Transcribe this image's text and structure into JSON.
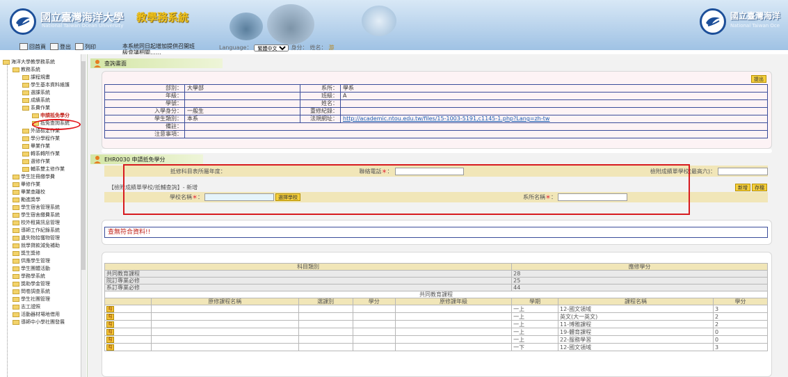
{
  "banner": {
    "school_name": "國立臺灣海洋大學",
    "school_name_en": "National Taiwan Ocean University",
    "system_name": "教學務系統",
    "school_name_right": "國立臺灣海洋",
    "school_name_en_right": "National Taiwan Oce"
  },
  "toolbar": {
    "home": "回首頁",
    "logout": "登出",
    "print": "列印",
    "notice": "本系統同日起增加提供召開班",
    "notice2": "級會議相關……",
    "language_label": "Language：",
    "language_value": "繁體中文",
    "user_label": "身分：",
    "name_label": "姓名：",
    "name_value": "游"
  },
  "sidebar": {
    "root": "海洋大學教學務系統",
    "items": [
      "教務系統",
      "課程規畫",
      "學生基本資料維護",
      "選課系統",
      "成績系統",
      "系費作業",
      "申請抵免學分",
      "抵免查詢系統",
      "外語檢定作業",
      "學分學程作業",
      "畢業作業",
      "轉系轉所作業",
      "選修作業",
      "輔系雙主修作業",
      "學生註冊繳學費",
      "畢修作業",
      "畢業查離校",
      "勵進獎學",
      "學生宿舍管理系統",
      "學生宿舍繳費系統",
      "校外租賃訊息管理",
      "導師工作紀錄系統",
      "遺失物拾獲物管理",
      "就學貸款減免補助",
      "獎生獎修",
      "供應學生管理",
      "學生團體活動",
      "學務學系統",
      "獎助學金管理",
      "問卷調查系統",
      "學生社團管理",
      "志工證照",
      "活動器材場地借用",
      "導師中小學社團發展"
    ]
  },
  "query": {
    "title": "查詢畫面",
    "button": "提出",
    "rows": [
      {
        "l1": "部別：",
        "v1": "大學部",
        "l2": "系所：",
        "v2": "學系"
      },
      {
        "l1": "年級：",
        "v1": "",
        "l2": "班級：",
        "v2": "A"
      },
      {
        "l1": "學號：",
        "v1": "",
        "l2": "姓名：",
        "v2": ""
      },
      {
        "l1": "入學身分：",
        "v1": "一般生",
        "l2": "重修紀錄：",
        "v2": ""
      },
      {
        "l1": "學生類別：",
        "v1": "本系",
        "l2": "法規網址：",
        "v2": "http://academic.ntou.edu.tw/files/15-1003-5191,c1145-1.php?Lang=zh-tw"
      },
      {
        "l1": "備註：",
        "v1": ""
      },
      {
        "l1": "注意事項：",
        "v1": ""
      }
    ]
  },
  "form": {
    "title": "EHR0030 申請抵免學分",
    "label_year": "抵修科目表所屬年度：",
    "label_phone": "聯絡電話",
    "label_max": "檢附成績單學校(最高六)：",
    "colon": "：",
    "asterisk": "＊",
    "sub_title": "【檢附成績單學校/抵輔查詢】- 新增",
    "add_btn": "新增",
    "save_btn": "存檔",
    "label_school": "學校名稱",
    "choose_school": "選擇學校",
    "label_dept": "系所名稱"
  },
  "nodata": "查無符合資料!!",
  "credits": {
    "header_type": "科目類別",
    "header_credit": "應修學分",
    "rows": [
      {
        "type": "共同教育課程",
        "credit": "28"
      },
      {
        "type": "院訂專業必修",
        "credit": "25"
      },
      {
        "type": "系訂專業必修",
        "credit": "44"
      }
    ],
    "group_header": "共同教育課程",
    "cols": [
      "原修課程名稱",
      "選課別",
      "學分",
      "原修課年級",
      "學期",
      "課程名稱",
      "學分"
    ],
    "courses": [
      {
        "sem": "一上",
        "name": "12-國文領域",
        "credit": "3"
      },
      {
        "sem": "一上",
        "name": "英文(大一英文)",
        "credit": "2"
      },
      {
        "sem": "一上",
        "name": "11-博雅課程",
        "credit": "2"
      },
      {
        "sem": "一上",
        "name": "19-體育課程",
        "credit": "0"
      },
      {
        "sem": "一上",
        "name": "22-服務學習",
        "credit": "0"
      },
      {
        "sem": "一下",
        "name": "12-國文領域",
        "credit": "3"
      }
    ],
    "pick": "勾"
  }
}
